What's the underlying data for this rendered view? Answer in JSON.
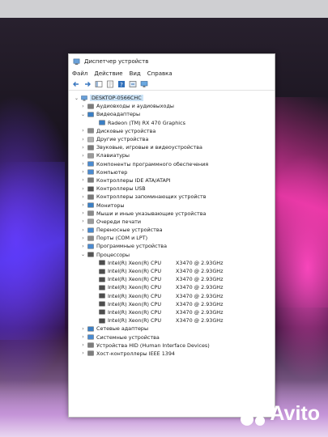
{
  "window": {
    "title": "Диспетчер устройств",
    "menu": [
      "Файл",
      "Действие",
      "Вид",
      "Справка"
    ]
  },
  "tree": {
    "root": "DESKTOP-0566CHC",
    "categories": [
      {
        "label": "Аудиовходы и аудиовыходы",
        "icon": "audio-icon"
      },
      {
        "label": "Видеоадаптеры",
        "icon": "display-adapter-icon",
        "expanded": true
      },
      {
        "label": "Дисковые устройства",
        "icon": "disk-icon"
      },
      {
        "label": "Другие устройства",
        "icon": "other-devices-icon"
      },
      {
        "label": "Звуковые, игровые и видеоустройства",
        "icon": "sound-icon"
      },
      {
        "label": "Клавиатуры",
        "icon": "keyboard-icon"
      },
      {
        "label": "Компоненты программного обеспечения",
        "icon": "software-icon"
      },
      {
        "label": "Компьютер",
        "icon": "computer-icon"
      },
      {
        "label": "Контроллеры IDE ATA/ATAPI",
        "icon": "ide-icon"
      },
      {
        "label": "Контроллеры USB",
        "icon": "usb-icon"
      },
      {
        "label": "Контроллеры запоминающих устройств",
        "icon": "storage-icon"
      },
      {
        "label": "Мониторы",
        "icon": "monitor-icon"
      },
      {
        "label": "Мыши и иные указывающие устройства",
        "icon": "mouse-icon"
      },
      {
        "label": "Очереди печати",
        "icon": "printer-icon"
      },
      {
        "label": "Переносные устройства",
        "icon": "portable-icon"
      },
      {
        "label": "Порты (COM и LPT)",
        "icon": "port-icon"
      },
      {
        "label": "Программные устройства",
        "icon": "software-device-icon"
      },
      {
        "label": "Процессоры",
        "icon": "processor-icon",
        "expanded": true
      },
      {
        "label": "Сетевые адаптеры",
        "icon": "network-icon"
      },
      {
        "label": "Системные устройства",
        "icon": "system-icon"
      },
      {
        "label": "Устройства HID (Human Interface Devices)",
        "icon": "hid-icon"
      },
      {
        "label": "Хост-контроллеры IEEE 1394",
        "icon": "ieee1394-icon"
      }
    ],
    "video_child": "Radeon (TM) RX 470 Graphics",
    "cpus": [
      {
        "name": "Intel(R) Xeon(R) CPU",
        "model": "X3470  @ 2.93GHz"
      },
      {
        "name": "Intel(R) Xeon(R) CPU",
        "model": "X3470  @ 2.93GHz"
      },
      {
        "name": "Intel(R) Xeon(R) CPU",
        "model": "X3470  @ 2.93GHz"
      },
      {
        "name": "Intel(R) Xeon(R) CPU",
        "model": "X3470  @ 2.93GHz"
      },
      {
        "name": "Intel(R) Xeon(R) CPU",
        "model": "X3470  @ 2.93GHz"
      },
      {
        "name": "Intel(R) Xeon(R) CPU",
        "model": "X3470  @ 2.93GHz"
      },
      {
        "name": "Intel(R) Xeon(R) CPU",
        "model": "X3470  @ 2.93GHz"
      },
      {
        "name": "Intel(R) Xeon(R) CPU",
        "model": "X3470  @ 2.93GHz"
      }
    ]
  },
  "watermark": "Avito",
  "colors": {
    "selection": "#cde4f7",
    "window_bg": "#ffffff"
  }
}
